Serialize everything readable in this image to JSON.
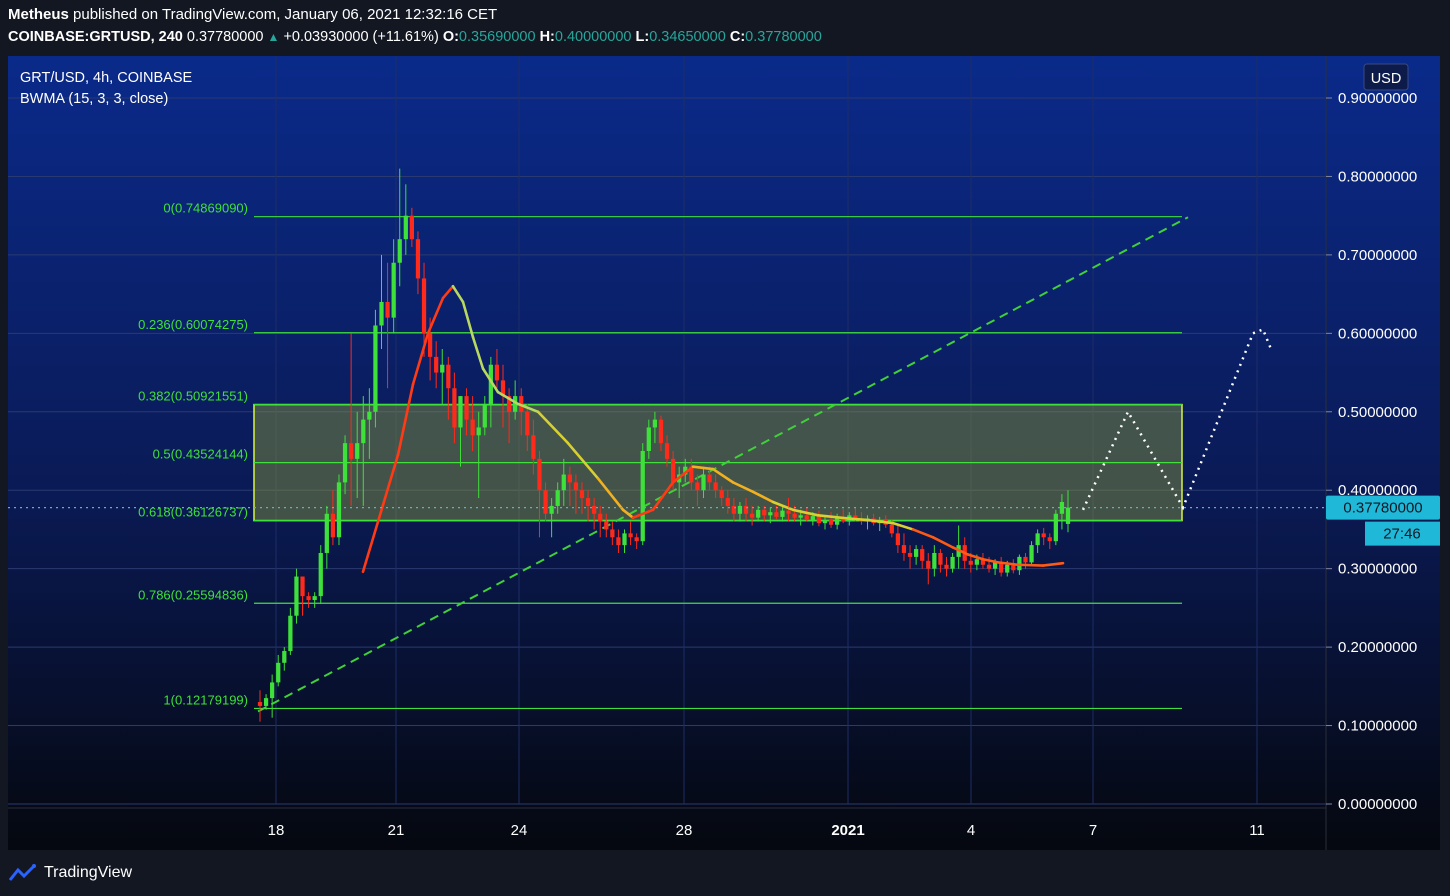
{
  "header": {
    "author": "Metheus",
    "published_text": "published on TradingView.com, January 06, 2021 12:32:16 CET",
    "symbol": "COINBASE:GRTUSD, 240",
    "last": "0.37780000",
    "change": "+0.03930000 (+11.61%)",
    "o_label": "O:",
    "o": "0.35690000",
    "h_label": "H:",
    "h": "0.40000000",
    "l_label": "L:",
    "l": "0.34650000",
    "c_label": "C:",
    "c": "0.37780000"
  },
  "legend": {
    "title": "GRT/USD, 4h, COINBASE",
    "indicator": "BWMA (15, 3, 3, close)"
  },
  "currency": "USD",
  "price_tag": "0.37780000",
  "countdown": "27:46",
  "footer": {
    "brand": "TradingView"
  },
  "colors": {
    "bg_top": "#0a2a8a",
    "bg_bottom": "#05080f",
    "candle_up": "#3ee03a",
    "candle_down": "#ff2a1a",
    "fib": "#3fe03a",
    "box_border": "#d8f542",
    "price_tag": "#1fb8d8"
  },
  "chart_data": {
    "type": "candlestick",
    "y_axis": {
      "ylim": [
        0,
        0.9
      ],
      "ticks": [
        "0.90000000",
        "0.80000000",
        "0.70000000",
        "0.60000000",
        "0.50000000",
        "0.40000000",
        "0.30000000",
        "0.20000000",
        "0.10000000",
        "0.00000000"
      ]
    },
    "x_axis": {
      "ticks": [
        "18",
        "21",
        "24",
        "28",
        "2021",
        "4",
        "7",
        "11"
      ]
    },
    "fib_levels": [
      {
        "label": "0(0.74869090)",
        "value": 0.7487
      },
      {
        "label": "0.236(0.60074275)",
        "value": 0.6007
      },
      {
        "label": "0.382(0.50921551)",
        "value": 0.5092
      },
      {
        "label": "0.5(0.43524144)",
        "value": 0.4352
      },
      {
        "label": "0.618(0.36126737)",
        "value": 0.3613
      },
      {
        "label": "0.786(0.25594836)",
        "value": 0.2559
      },
      {
        "label": "1(0.12179199)",
        "value": 0.1218
      }
    ],
    "zone": {
      "from": 0.3613,
      "to": 0.5092
    },
    "last_price": 0.3778,
    "candles": [
      [
        0.13,
        0.145,
        0.105,
        0.125
      ],
      [
        0.125,
        0.14,
        0.12,
        0.135
      ],
      [
        0.135,
        0.165,
        0.11,
        0.155
      ],
      [
        0.155,
        0.19,
        0.15,
        0.18
      ],
      [
        0.18,
        0.2,
        0.17,
        0.195
      ],
      [
        0.195,
        0.25,
        0.19,
        0.24
      ],
      [
        0.24,
        0.3,
        0.23,
        0.29
      ],
      [
        0.29,
        0.28,
        0.24,
        0.265
      ],
      [
        0.265,
        0.27,
        0.25,
        0.26
      ],
      [
        0.26,
        0.27,
        0.25,
        0.265
      ],
      [
        0.265,
        0.33,
        0.255,
        0.32
      ],
      [
        0.32,
        0.38,
        0.3,
        0.37
      ],
      [
        0.37,
        0.4,
        0.33,
        0.34
      ],
      [
        0.34,
        0.42,
        0.33,
        0.41
      ],
      [
        0.41,
        0.47,
        0.395,
        0.46
      ],
      [
        0.46,
        0.6,
        0.38,
        0.44
      ],
      [
        0.44,
        0.5,
        0.39,
        0.46
      ],
      [
        0.46,
        0.52,
        0.38,
        0.49
      ],
      [
        0.49,
        0.53,
        0.44,
        0.5
      ],
      [
        0.5,
        0.63,
        0.48,
        0.61
      ],
      [
        0.61,
        0.7,
        0.58,
        0.64
      ],
      [
        0.64,
        0.69,
        0.53,
        0.62
      ],
      [
        0.62,
        0.72,
        0.6,
        0.69
      ],
      [
        0.69,
        0.81,
        0.66,
        0.72
      ],
      [
        0.72,
        0.79,
        0.7,
        0.75
      ],
      [
        0.75,
        0.76,
        0.71,
        0.72
      ],
      [
        0.72,
        0.73,
        0.65,
        0.67
      ],
      [
        0.67,
        0.69,
        0.57,
        0.6
      ],
      [
        0.6,
        0.62,
        0.54,
        0.57
      ],
      [
        0.57,
        0.59,
        0.53,
        0.55
      ],
      [
        0.55,
        0.58,
        0.51,
        0.56
      ],
      [
        0.56,
        0.57,
        0.49,
        0.53
      ],
      [
        0.53,
        0.55,
        0.46,
        0.48
      ],
      [
        0.48,
        0.52,
        0.43,
        0.52
      ],
      [
        0.52,
        0.53,
        0.47,
        0.49
      ],
      [
        0.49,
        0.52,
        0.45,
        0.47
      ],
      [
        0.47,
        0.5,
        0.39,
        0.48
      ],
      [
        0.48,
        0.52,
        0.47,
        0.51
      ],
      [
        0.51,
        0.57,
        0.48,
        0.56
      ],
      [
        0.56,
        0.58,
        0.53,
        0.54
      ],
      [
        0.54,
        0.56,
        0.48,
        0.52
      ],
      [
        0.52,
        0.53,
        0.46,
        0.5
      ],
      [
        0.5,
        0.54,
        0.49,
        0.52
      ],
      [
        0.52,
        0.53,
        0.47,
        0.5
      ],
      [
        0.5,
        0.51,
        0.45,
        0.47
      ],
      [
        0.47,
        0.49,
        0.42,
        0.44
      ],
      [
        0.44,
        0.45,
        0.34,
        0.4
      ],
      [
        0.4,
        0.41,
        0.36,
        0.37
      ],
      [
        0.37,
        0.39,
        0.34,
        0.38
      ],
      [
        0.38,
        0.41,
        0.37,
        0.4
      ],
      [
        0.4,
        0.44,
        0.38,
        0.42
      ],
      [
        0.42,
        0.43,
        0.38,
        0.41
      ],
      [
        0.41,
        0.42,
        0.37,
        0.4
      ],
      [
        0.4,
        0.41,
        0.37,
        0.39
      ],
      [
        0.39,
        0.4,
        0.36,
        0.38
      ],
      [
        0.38,
        0.39,
        0.35,
        0.37
      ],
      [
        0.37,
        0.38,
        0.34,
        0.36
      ],
      [
        0.36,
        0.37,
        0.34,
        0.35
      ],
      [
        0.35,
        0.36,
        0.33,
        0.34
      ],
      [
        0.34,
        0.35,
        0.32,
        0.33
      ],
      [
        0.33,
        0.35,
        0.32,
        0.345
      ],
      [
        0.345,
        0.36,
        0.33,
        0.34
      ],
      [
        0.34,
        0.345,
        0.325,
        0.335
      ],
      [
        0.335,
        0.46,
        0.33,
        0.45
      ],
      [
        0.45,
        0.49,
        0.44,
        0.48
      ],
      [
        0.48,
        0.5,
        0.46,
        0.49
      ],
      [
        0.49,
        0.495,
        0.45,
        0.46
      ],
      [
        0.46,
        0.47,
        0.43,
        0.44
      ],
      [
        0.44,
        0.45,
        0.4,
        0.41
      ],
      [
        0.41,
        0.43,
        0.39,
        0.42
      ],
      [
        0.42,
        0.44,
        0.41,
        0.43
      ],
      [
        0.43,
        0.44,
        0.4,
        0.41
      ],
      [
        0.41,
        0.42,
        0.38,
        0.4
      ],
      [
        0.4,
        0.43,
        0.39,
        0.42
      ],
      [
        0.42,
        0.43,
        0.4,
        0.41
      ],
      [
        0.41,
        0.42,
        0.39,
        0.4
      ],
      [
        0.4,
        0.405,
        0.38,
        0.39
      ],
      [
        0.39,
        0.4,
        0.37,
        0.38
      ],
      [
        0.38,
        0.39,
        0.36,
        0.37
      ],
      [
        0.37,
        0.385,
        0.36,
        0.38
      ],
      [
        0.38,
        0.39,
        0.36,
        0.37
      ],
      [
        0.37,
        0.38,
        0.355,
        0.365
      ],
      [
        0.365,
        0.38,
        0.36,
        0.375
      ],
      [
        0.375,
        0.38,
        0.36,
        0.368
      ],
      [
        0.368,
        0.378,
        0.358,
        0.372
      ],
      [
        0.372,
        0.38,
        0.362,
        0.366
      ],
      [
        0.366,
        0.378,
        0.36,
        0.374
      ],
      [
        0.374,
        0.39,
        0.36,
        0.37
      ],
      [
        0.37,
        0.38,
        0.36,
        0.365
      ],
      [
        0.365,
        0.375,
        0.355,
        0.368
      ],
      [
        0.368,
        0.378,
        0.36,
        0.362
      ],
      [
        0.362,
        0.372,
        0.355,
        0.367
      ],
      [
        0.367,
        0.374,
        0.354,
        0.358
      ],
      [
        0.358,
        0.368,
        0.35,
        0.362
      ],
      [
        0.362,
        0.372,
        0.352,
        0.356
      ],
      [
        0.356,
        0.37,
        0.35,
        0.365
      ],
      [
        0.365,
        0.376,
        0.358,
        0.36
      ],
      [
        0.36,
        0.372,
        0.355,
        0.368
      ],
      [
        0.368,
        0.378,
        0.36,
        0.364
      ],
      [
        0.364,
        0.372,
        0.356,
        0.36
      ],
      [
        0.36,
        0.368,
        0.35,
        0.364
      ],
      [
        0.364,
        0.37,
        0.355,
        0.358
      ],
      [
        0.358,
        0.366,
        0.348,
        0.362
      ],
      [
        0.362,
        0.368,
        0.352,
        0.356
      ],
      [
        0.356,
        0.362,
        0.34,
        0.345
      ],
      [
        0.345,
        0.355,
        0.32,
        0.33
      ],
      [
        0.33,
        0.345,
        0.31,
        0.32
      ],
      [
        0.32,
        0.33,
        0.3,
        0.315
      ],
      [
        0.315,
        0.33,
        0.305,
        0.325
      ],
      [
        0.325,
        0.33,
        0.3,
        0.31
      ],
      [
        0.31,
        0.32,
        0.28,
        0.3
      ],
      [
        0.3,
        0.33,
        0.29,
        0.32
      ],
      [
        0.32,
        0.325,
        0.295,
        0.305
      ],
      [
        0.305,
        0.315,
        0.29,
        0.3
      ],
      [
        0.3,
        0.32,
        0.295,
        0.315
      ],
      [
        0.315,
        0.355,
        0.3,
        0.33
      ],
      [
        0.33,
        0.34,
        0.3,
        0.31
      ],
      [
        0.31,
        0.32,
        0.295,
        0.305
      ],
      [
        0.305,
        0.318,
        0.298,
        0.312
      ],
      [
        0.312,
        0.32,
        0.3,
        0.305
      ],
      [
        0.305,
        0.315,
        0.295,
        0.3
      ],
      [
        0.3,
        0.312,
        0.292,
        0.308
      ],
      [
        0.308,
        0.315,
        0.29,
        0.295
      ],
      [
        0.295,
        0.31,
        0.29,
        0.305
      ],
      [
        0.305,
        0.312,
        0.294,
        0.298
      ],
      [
        0.298,
        0.318,
        0.292,
        0.315
      ],
      [
        0.315,
        0.32,
        0.3,
        0.308
      ],
      [
        0.308,
        0.335,
        0.305,
        0.33
      ],
      [
        0.33,
        0.35,
        0.32,
        0.345
      ],
      [
        0.345,
        0.352,
        0.33,
        0.34
      ],
      [
        0.34,
        0.345,
        0.325,
        0.335
      ],
      [
        0.335,
        0.375,
        0.33,
        0.37
      ],
      [
        0.37,
        0.395,
        0.35,
        0.385
      ],
      [
        0.357,
        0.4,
        0.3465,
        0.3778
      ]
    ],
    "bwma": [
      [
        0.355,
        0.296
      ],
      [
        0.39,
        0.445
      ],
      [
        0.405,
        0.535
      ],
      [
        0.42,
        0.6
      ],
      [
        0.435,
        0.645
      ],
      [
        0.445,
        0.66
      ],
      [
        0.455,
        0.64
      ],
      [
        0.465,
        0.595
      ],
      [
        0.475,
        0.555
      ],
      [
        0.49,
        0.525
      ],
      [
        0.51,
        0.51
      ],
      [
        0.53,
        0.5
      ],
      [
        0.56,
        0.46
      ],
      [
        0.59,
        0.415
      ],
      [
        0.615,
        0.375
      ],
      [
        0.625,
        0.365
      ],
      [
        0.645,
        0.375
      ],
      [
        0.665,
        0.41
      ],
      [
        0.685,
        0.43
      ],
      [
        0.705,
        0.427
      ],
      [
        0.725,
        0.41
      ],
      [
        0.745,
        0.398
      ],
      [
        0.765,
        0.385
      ],
      [
        0.785,
        0.375
      ],
      [
        0.81,
        0.368
      ],
      [
        0.84,
        0.364
      ],
      [
        0.86,
        0.362
      ],
      [
        0.885,
        0.358
      ],
      [
        0.905,
        0.35
      ],
      [
        0.925,
        0.34
      ],
      [
        0.945,
        0.327
      ],
      [
        0.96,
        0.318
      ],
      [
        0.975,
        0.312
      ],
      [
        0.99,
        0.308
      ],
      [
        1.01,
        0.305
      ],
      [
        1.035,
        0.304
      ],
      [
        1.055,
        0.307
      ]
    ],
    "trendline": [
      [
        0.25,
        0.118
      ],
      [
        1.18,
        0.748
      ]
    ],
    "projection": [
      [
        1.075,
        0.375
      ],
      [
        1.12,
        0.5
      ],
      [
        1.175,
        0.378
      ],
      [
        1.245,
        0.6
      ],
      [
        1.255,
        0.605
      ],
      [
        1.263,
        0.58
      ]
    ]
  }
}
